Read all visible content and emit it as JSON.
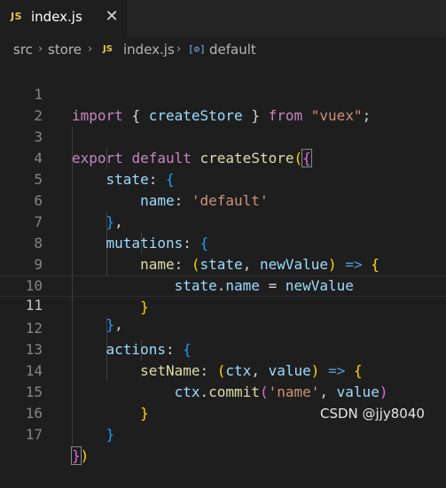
{
  "tab": {
    "badge": "JS",
    "filename": "index.js",
    "close_glyph": "✕"
  },
  "breadcrumb": {
    "items": [
      "src",
      "store",
      "index.js",
      "default"
    ],
    "file_badge": "JS",
    "symbol_icon": "[⊘]",
    "separator": "›"
  },
  "editor": {
    "current_line": 11,
    "lines": [
      {
        "n": "1"
      },
      {
        "n": "2"
      },
      {
        "n": "3"
      },
      {
        "n": "4"
      },
      {
        "n": "5"
      },
      {
        "n": "6"
      },
      {
        "n": "7"
      },
      {
        "n": "8"
      },
      {
        "n": "9"
      },
      {
        "n": "10"
      },
      {
        "n": "11"
      },
      {
        "n": "12"
      },
      {
        "n": "13"
      },
      {
        "n": "14"
      },
      {
        "n": "15"
      },
      {
        "n": "16"
      },
      {
        "n": "17"
      }
    ],
    "tokens": {
      "l1": [
        "import",
        "{",
        "createStore",
        "}",
        "from",
        "\"vuex\"",
        ";"
      ],
      "l3": [
        "export",
        "default",
        "createStore",
        "(",
        "{"
      ],
      "l4": [
        "state",
        ":",
        "{"
      ],
      "l5": [
        "name",
        ":",
        "'default'"
      ],
      "l6": [
        "}",
        ","
      ],
      "l7": [
        "mutations",
        ":",
        "{"
      ],
      "l8": [
        "name",
        ":",
        "(",
        "state",
        ",",
        "newValue",
        ")",
        "=>",
        "{"
      ],
      "l9": [
        "state",
        ".",
        "name",
        "=",
        "newValue"
      ],
      "l10": [
        "}"
      ],
      "l11": [
        "}",
        ","
      ],
      "l12": [
        "actions",
        ":",
        "{"
      ],
      "l13": [
        "setName",
        ":",
        "(",
        "ctx",
        ",",
        "value",
        ")",
        "=>",
        "{"
      ],
      "l14": [
        "ctx",
        ".",
        "commit",
        "(",
        "'name'",
        ",",
        "value",
        ")"
      ],
      "l15": [
        "}"
      ],
      "l16": [
        "}"
      ],
      "l17": [
        "}",
        ")"
      ]
    }
  },
  "watermark": "CSDN @jjy8040",
  "colors": {
    "background": "#1e1e1e",
    "keyword": "#c586c0",
    "storage": "#569cd6",
    "function": "#dcdcaa",
    "variable": "#9cdcfe",
    "string": "#ce9178",
    "bracket_level1": "#ffd700",
    "bracket_level2": "#da70d6",
    "bracket_level3": "#179fff"
  }
}
